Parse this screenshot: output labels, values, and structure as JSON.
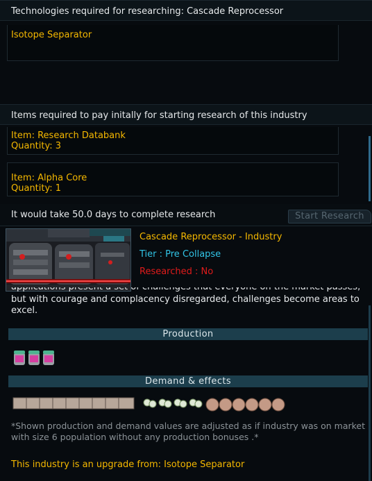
{
  "tech_section": {
    "header": "Technologies required for researching: Cascade Reprocessor",
    "items": [
      "Isotope Separator"
    ]
  },
  "items_section": {
    "header": "Items required to pay initally for starting research of this industry",
    "items": [
      {
        "item": "Item: Research Databank",
        "quantity": "Quantity: 3"
      },
      {
        "item": "Item: Alpha Core",
        "quantity": "Quantity: 1"
      }
    ]
  },
  "research": {
    "time_text": "It would take 50.0 days to complete research",
    "start_button": "Start Research"
  },
  "industry": {
    "name": "Cascade Reprocessor - Industry",
    "tier": "Tier : Pre Collapse",
    "researched": "Researched : No",
    "description_cut": "applications present a set of challenges that everyone on the market passes,",
    "description": "but with courage and complacency disregarded, challenges become areas to excel."
  },
  "production": {
    "title": "Production",
    "icons": [
      "rare-metal-canister-icon",
      "rare-metal-canister-icon",
      "rare-metal-canister-icon"
    ]
  },
  "demand": {
    "title": "Demand & effects",
    "groups": [
      {
        "name": "heavy-machinery-icon",
        "count": 9
      },
      {
        "name": "organics-icon",
        "count": 4
      },
      {
        "name": "ore-sack-icon",
        "count": 6
      }
    ]
  },
  "note": "*Shown production and demand values are adjusted as if industry was on market with size 6 population without any production bonuses .*",
  "upgrade": "This industry is an upgrade from: Isotope Separator",
  "colors": {
    "accent": "#f5b800",
    "tier": "#31c4e6",
    "researched_no": "#e01b1b",
    "section_bar": "#1c3e4c"
  }
}
